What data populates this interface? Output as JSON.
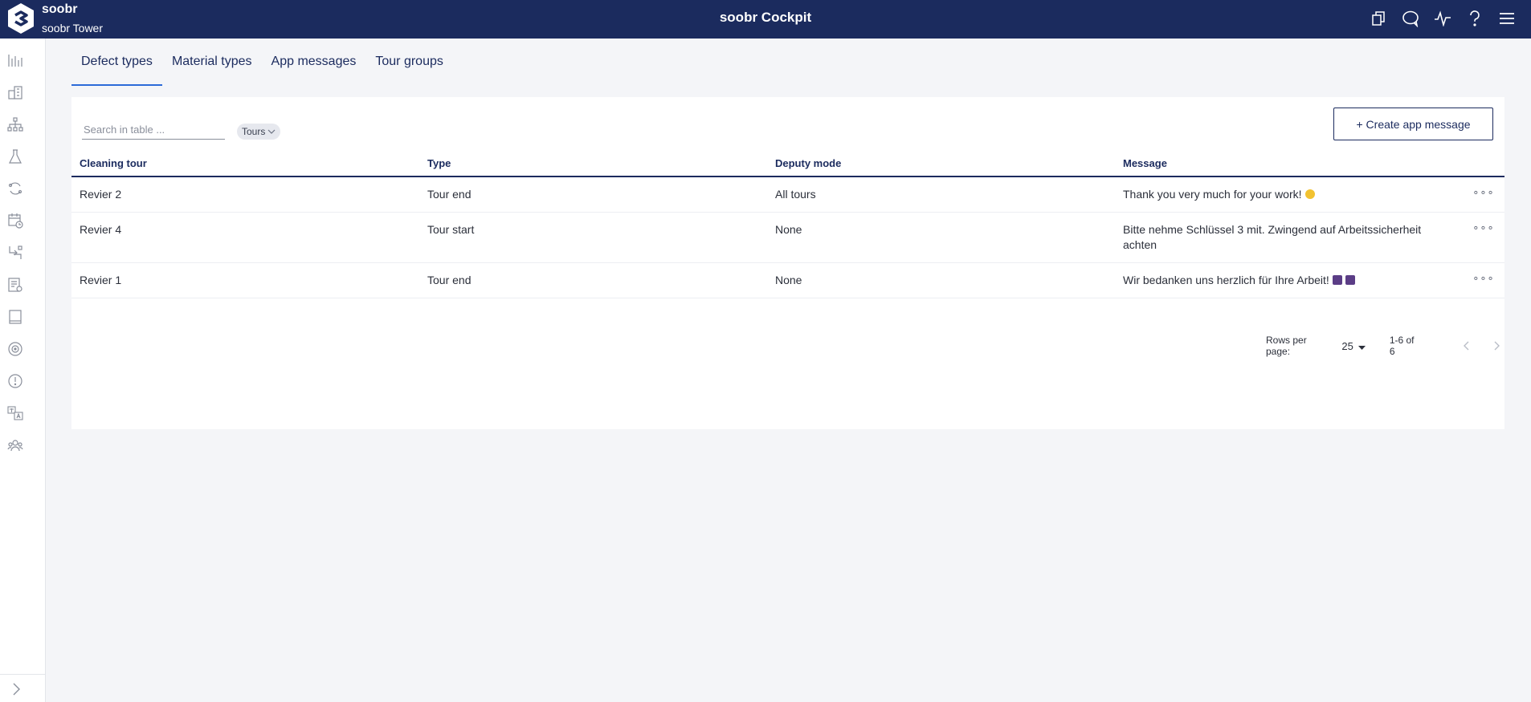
{
  "header": {
    "brand_name": "soobr",
    "site_name": "soobr Tower",
    "app_title": "soobr Cockpit",
    "icons": [
      "copy-icon",
      "chat-icon",
      "activity-icon",
      "help-icon",
      "menu-icon"
    ],
    "background": "#1b2b5e"
  },
  "sidebar": {
    "items": [
      {
        "icon": "bar-chart-icon"
      },
      {
        "icon": "building-icon"
      },
      {
        "icon": "hierarchy-icon"
      },
      {
        "icon": "flask-icon"
      },
      {
        "icon": "refresh-cycle-icon"
      },
      {
        "icon": "calendar-clock-icon"
      },
      {
        "icon": "swap-icon"
      },
      {
        "icon": "document-settings-icon"
      },
      {
        "icon": "tablet-icon"
      },
      {
        "icon": "target-icon"
      },
      {
        "icon": "alert-circle-icon"
      },
      {
        "icon": "translate-icon"
      },
      {
        "icon": "team-icon"
      }
    ],
    "expand_icon": "chevron-right-icon"
  },
  "tabs": [
    {
      "label": "Defect types",
      "active": true
    },
    {
      "label": "Material types",
      "active": false
    },
    {
      "label": "App messages",
      "active": false
    },
    {
      "label": "Tour groups",
      "active": false
    }
  ],
  "toolbar": {
    "search_placeholder": "Search in table ...",
    "filter_chip": "Tours",
    "create_label": "+ Create app message"
  },
  "table": {
    "columns": [
      "Cleaning tour",
      "Type",
      "Deputy mode",
      "Message"
    ],
    "rows": [
      {
        "tour": "Revier 2",
        "type": "Tour end",
        "deputy": "All tours",
        "message": "Thank you very much for your work!"
      },
      {
        "tour": "Revier 4",
        "type": "Tour start",
        "deputy": "None",
        "message": "Bitte nehme Schlüssel 3 mit. Zwingend auf Arbeitssicherheit achten"
      },
      {
        "tour": "Revier 1",
        "type": "Tour end",
        "deputy": "None",
        "message": "Wir bedanken uns herzlich für Ihre Arbeit!"
      }
    ],
    "row_actions_label": "∘∘∘"
  },
  "pagination": {
    "rows_per_page_label": "Rows per page:",
    "rows_per_page": "25",
    "range": "1-6 of 6"
  },
  "colors": {
    "accent": "#2c6ad8",
    "primary": "#1b2b5e"
  }
}
